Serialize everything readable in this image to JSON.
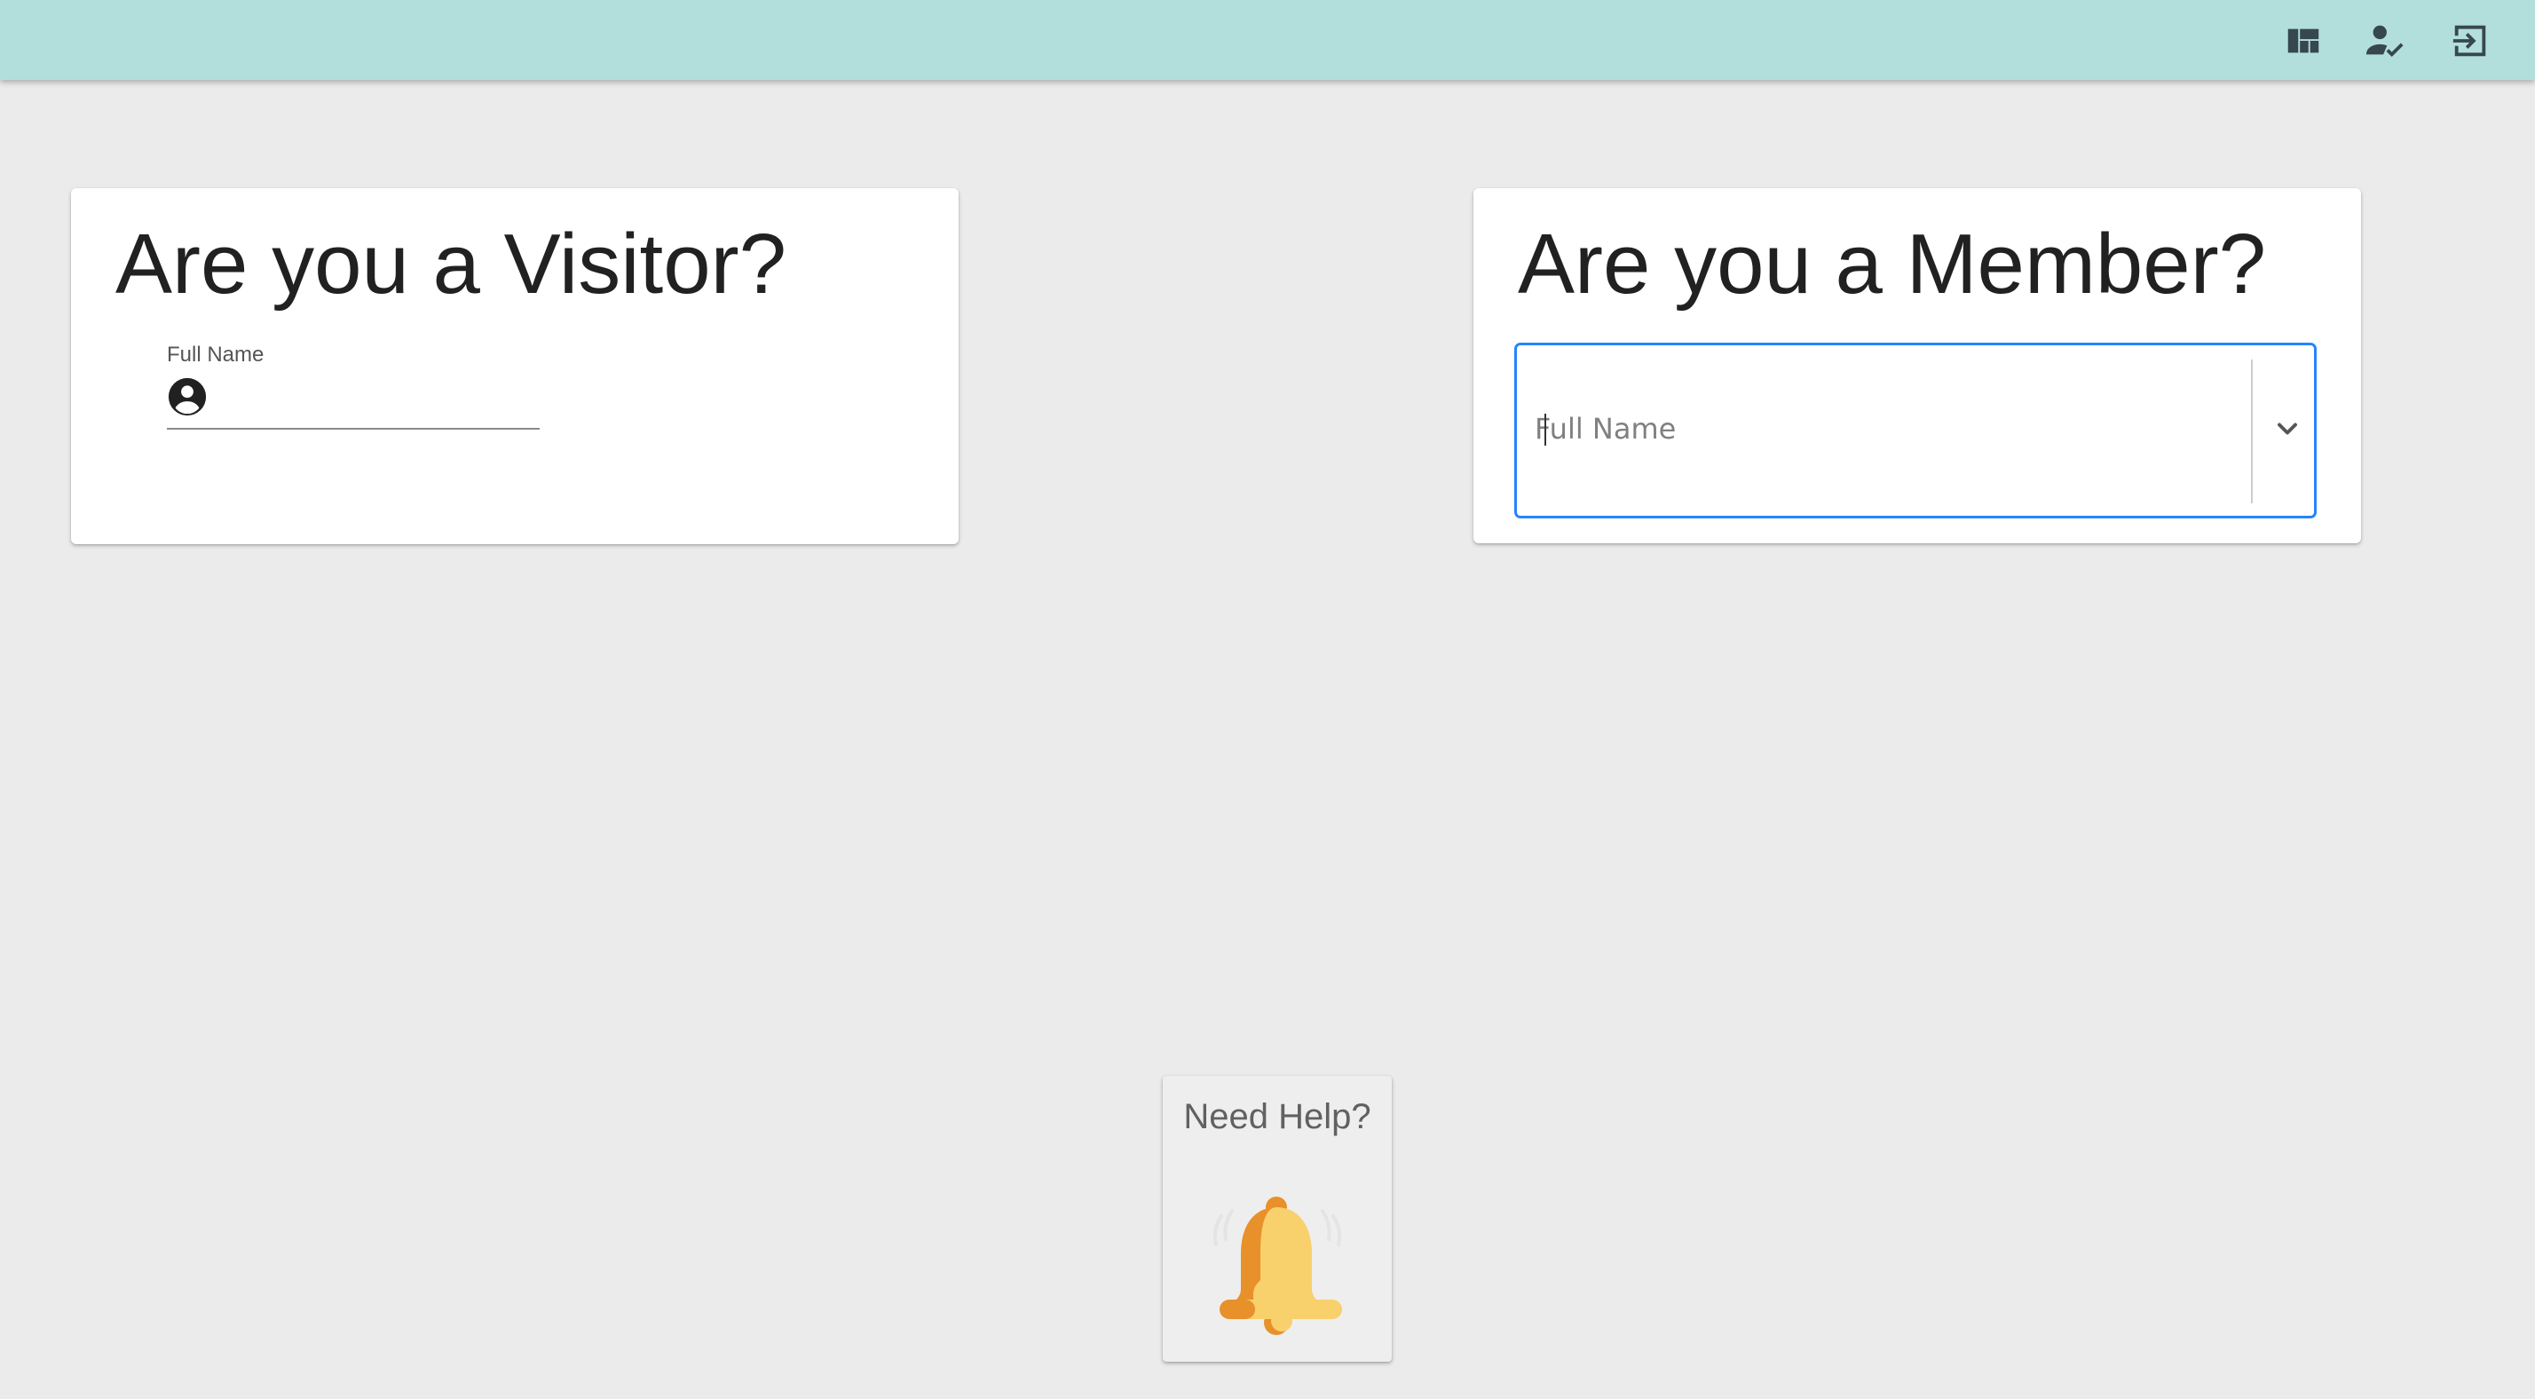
{
  "topbar": {
    "icons": [
      "dashboard-icon",
      "person-check-icon",
      "logout-icon"
    ],
    "color": "#b2dfdb"
  },
  "visitor": {
    "title": "Are you a Visitor?",
    "field_label": "Full Name",
    "field_value": ""
  },
  "member": {
    "title": "Are you a Member?",
    "placeholder": "Full Name",
    "value": "",
    "focus_color": "#2684ff"
  },
  "help": {
    "label": "Need Help?",
    "icon": "bell-icon"
  }
}
